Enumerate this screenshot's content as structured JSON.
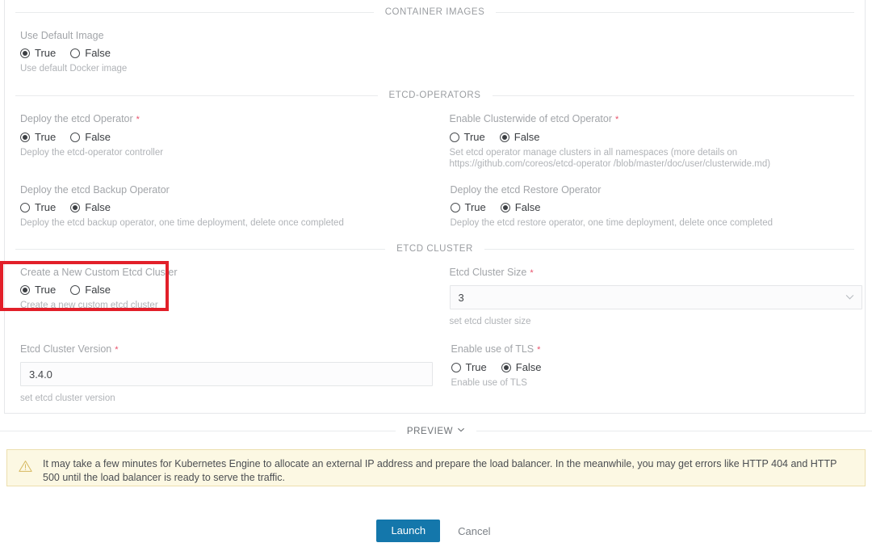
{
  "sections": {
    "container_images": {
      "title": "CONTAINER IMAGES"
    },
    "etcd_operators": {
      "title": "ETCD-OPERATORS"
    },
    "etcd_cluster": {
      "title": "ETCD CLUSTER"
    }
  },
  "radio_labels": {
    "true": "True",
    "false": "False"
  },
  "fields": {
    "use_default_image": {
      "label": "Use Default Image",
      "required": false,
      "value": "True",
      "help": "Use default Docker image"
    },
    "deploy_etcd_operator": {
      "label": "Deploy the etcd Operator",
      "required": true,
      "value": "True",
      "help": "Deploy the etcd-operator controller"
    },
    "enable_clusterwide": {
      "label": "Enable Clusterwide of etcd Operator",
      "required": true,
      "value": "False",
      "help": "Set etcd operator manage clusters in all namespaces (more details on https://github.com/coreos/etcd-operator /blob/master/doc/user/clusterwide.md)"
    },
    "deploy_backup_operator": {
      "label": "Deploy the etcd Backup Operator",
      "required": false,
      "value": "False",
      "help": "Deploy the etcd backup operator, one time deployment, delete once completed"
    },
    "deploy_restore_operator": {
      "label": "Deploy the etcd Restore Operator",
      "required": false,
      "value": "False",
      "help": "Deploy the etcd restore operator, one time deployment, delete once completed"
    },
    "create_custom_cluster": {
      "label": "Create a New Custom Etcd Cluster",
      "required": false,
      "value": "True",
      "help": "Create a new custom etcd cluster"
    },
    "etcd_cluster_size": {
      "label": "Etcd Cluster Size",
      "required": true,
      "value": "3",
      "help": "set etcd cluster size"
    },
    "etcd_cluster_version": {
      "label": "Etcd Cluster Version",
      "required": true,
      "value": "3.4.0",
      "placeholder": "",
      "help": "set etcd cluster version"
    },
    "enable_tls": {
      "label": "Enable use of TLS",
      "required": true,
      "value": "False",
      "help": "Enable use of TLS"
    }
  },
  "preview": {
    "label": "PREVIEW",
    "chevron": "chevron-down-icon"
  },
  "warning": {
    "icon": "warning-triangle-icon",
    "text": "It may take a few minutes for Kubernetes Engine to allocate an external IP address and prepare the load balancer. In the meanwhile, you may get errors like HTTP 404 and HTTP 500 until the load balancer is ready to serve the traffic."
  },
  "actions": {
    "launch": "Launch",
    "cancel": "Cancel"
  },
  "annotation": {
    "kind": "highlight-box",
    "color": "#e21f29"
  },
  "colors": {
    "accent": "#1477ab",
    "required_asterisk": "#e8506a",
    "warning_bg": "#fcf8e3",
    "warning_border": "#ecdfae",
    "annotation_red": "#e21f29"
  }
}
